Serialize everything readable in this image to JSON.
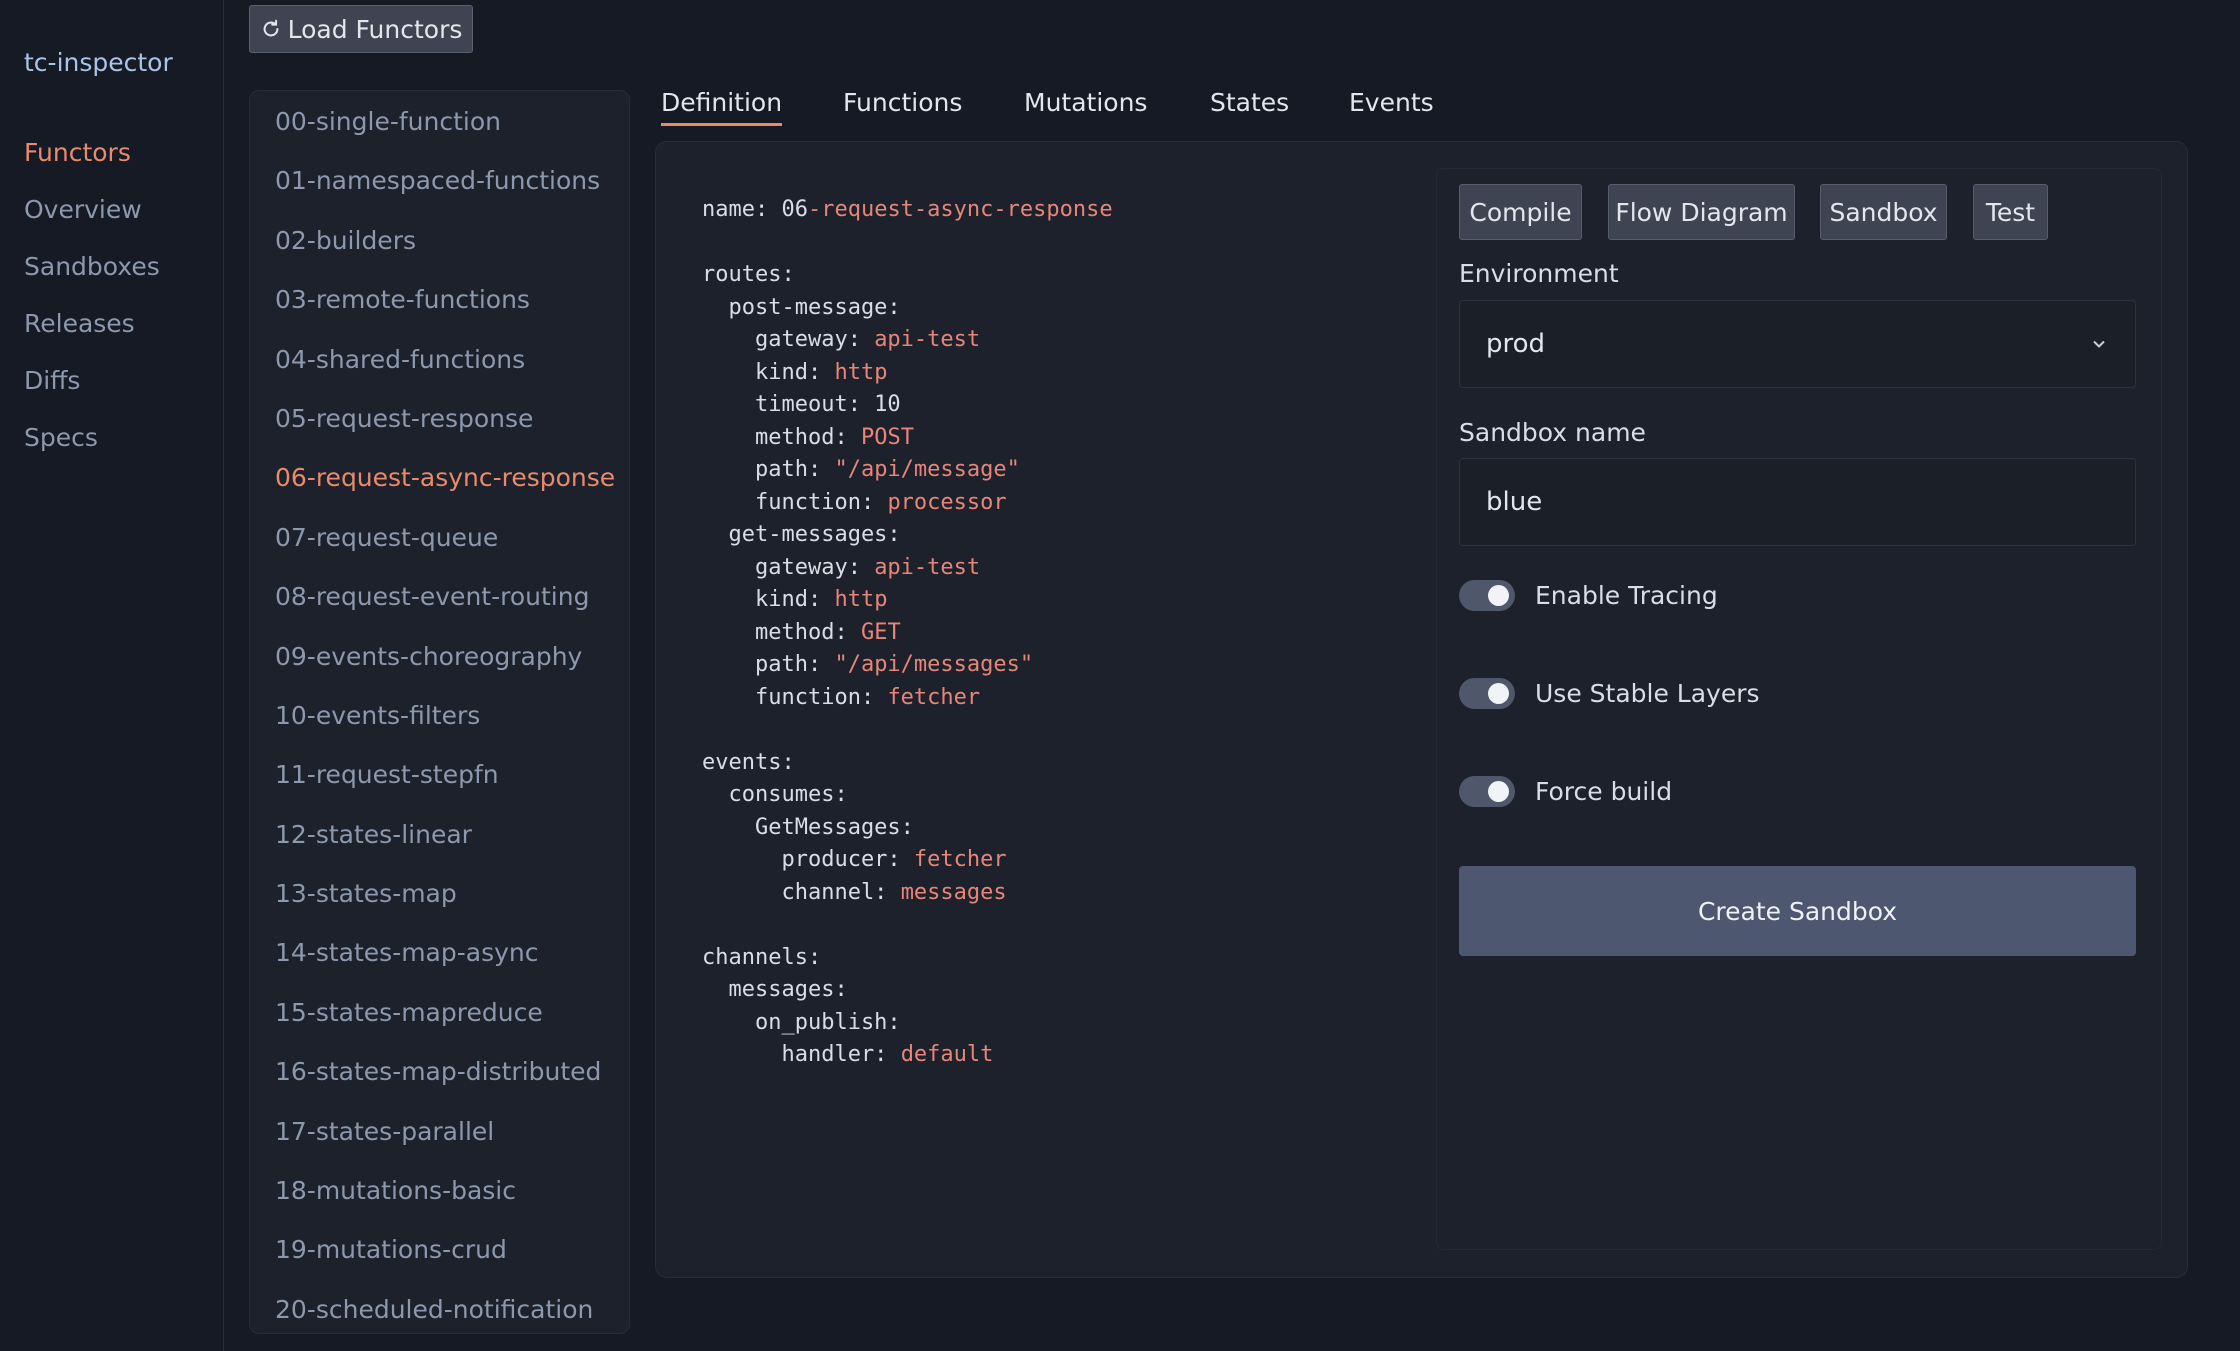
{
  "app": {
    "brand": "tc-inspector"
  },
  "nav": {
    "items": [
      {
        "label": "Functors",
        "active": true
      },
      {
        "label": "Overview",
        "active": false
      },
      {
        "label": "Sandboxes",
        "active": false
      },
      {
        "label": "Releases",
        "active": false
      },
      {
        "label": "Diffs",
        "active": false
      },
      {
        "label": "Specs",
        "active": false
      }
    ]
  },
  "toolbar": {
    "load_label": "Load Functors"
  },
  "functors": {
    "items": [
      "00-single-function",
      "01-namespaced-functions",
      "02-builders",
      "03-remote-functions",
      "04-shared-functions",
      "05-request-response",
      "06-request-async-response",
      "07-request-queue",
      "08-request-event-routing",
      "09-events-choreography",
      "10-events-filters",
      "11-request-stepfn",
      "12-states-linear",
      "13-states-map",
      "14-states-map-async",
      "15-states-mapreduce",
      "16-states-map-distributed",
      "17-states-parallel",
      "18-mutations-basic",
      "19-mutations-crud",
      "20-scheduled-notification"
    ],
    "active": "06-request-async-response"
  },
  "tabs": [
    {
      "label": "Definition",
      "active": true
    },
    {
      "label": "Functions",
      "active": false
    },
    {
      "label": "Mutations",
      "active": false
    },
    {
      "label": "States",
      "active": false
    },
    {
      "label": "Events",
      "active": false
    }
  ],
  "definition": {
    "lines": [
      [
        "name: 06",
        "-request-async-response"
      ],
      [
        "",
        ""
      ],
      [
        "routes:",
        ""
      ],
      [
        "  post-message:",
        ""
      ],
      [
        "    gateway: ",
        "api-test"
      ],
      [
        "    kind: ",
        "http"
      ],
      [
        "    timeout: 10",
        ""
      ],
      [
        "    method: ",
        "POST"
      ],
      [
        "    path: ",
        "\"/api/message\""
      ],
      [
        "    function: ",
        "processor"
      ],
      [
        "  get-messages:",
        ""
      ],
      [
        "    gateway: ",
        "api-test"
      ],
      [
        "    kind: ",
        "http"
      ],
      [
        "    method: ",
        "GET"
      ],
      [
        "    path: ",
        "\"/api/messages\""
      ],
      [
        "    function: ",
        "fetcher"
      ],
      [
        "",
        ""
      ],
      [
        "events:",
        ""
      ],
      [
        "  consumes:",
        ""
      ],
      [
        "    GetMessages:",
        ""
      ],
      [
        "      producer: ",
        "fetcher"
      ],
      [
        "      channel: ",
        "messages"
      ],
      [
        "",
        ""
      ],
      [
        "channels:",
        ""
      ],
      [
        "  messages:",
        ""
      ],
      [
        "    on_publish:",
        ""
      ],
      [
        "      handler: ",
        "default"
      ]
    ]
  },
  "actions": {
    "compile": "Compile",
    "flow_diagram": "Flow Diagram",
    "sandbox": "Sandbox",
    "test": "Test"
  },
  "form": {
    "environment_label": "Environment",
    "environment_value": "prod",
    "sandbox_name_label": "Sandbox name",
    "sandbox_name_value": "blue",
    "toggles": [
      {
        "label": "Enable Tracing",
        "on": true
      },
      {
        "label": "Use Stable Layers",
        "on": true
      },
      {
        "label": "Force build",
        "on": true
      }
    ],
    "create_label": "Create Sandbox"
  }
}
